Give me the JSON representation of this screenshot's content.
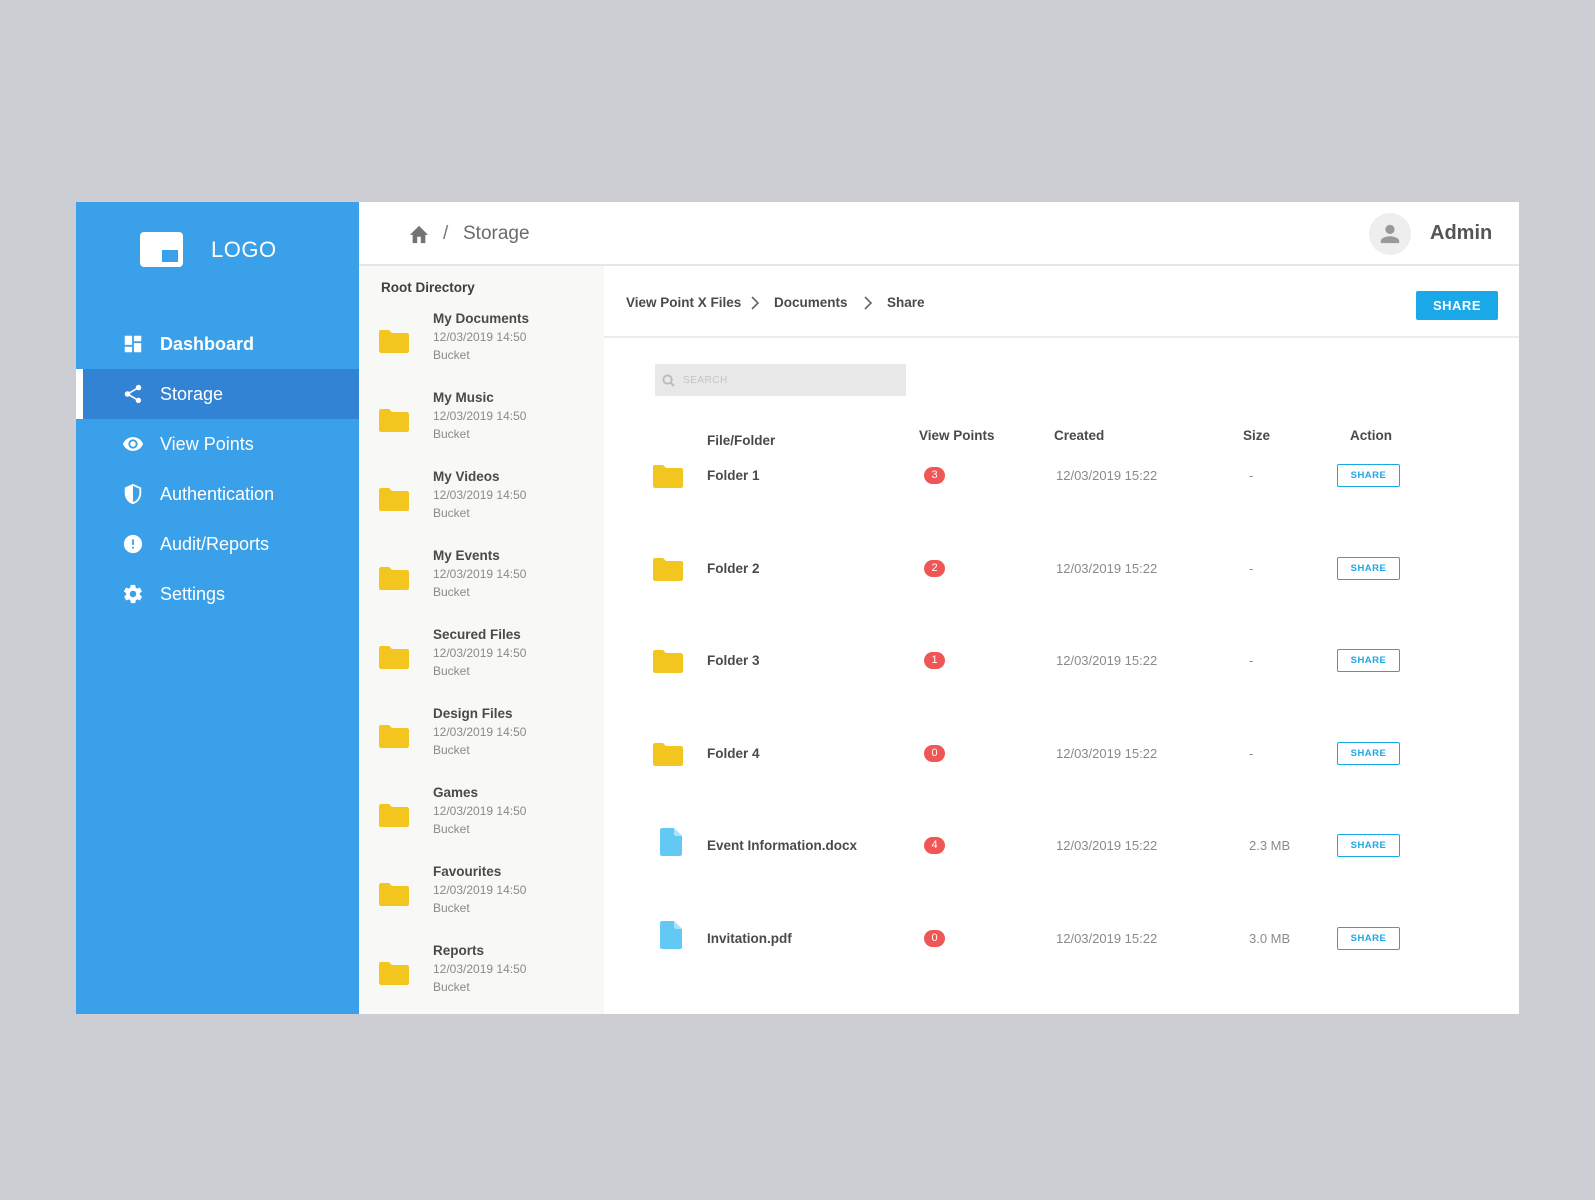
{
  "sidebar": {
    "logo_text": "LOGO",
    "items": [
      {
        "label": "Dashboard",
        "icon": "dashboard-icon"
      },
      {
        "label": "Storage",
        "icon": "share-icon"
      },
      {
        "label": "View Points",
        "icon": "eye-icon"
      },
      {
        "label": "Authentication",
        "icon": "shield-icon"
      },
      {
        "label": "Audit/Reports",
        "icon": "alert-icon"
      },
      {
        "label": "Settings",
        "icon": "gear-icon"
      }
    ],
    "active_item": "Storage"
  },
  "header": {
    "separator": "/",
    "title": "Storage",
    "user_name": "Admin"
  },
  "root_directory": {
    "title": "Root Directory",
    "items": [
      {
        "name": "My Documents",
        "date": "12/03/2019 14:50",
        "tag": "Bucket"
      },
      {
        "name": "My Music",
        "date": "12/03/2019 14:50",
        "tag": "Bucket"
      },
      {
        "name": "My Videos",
        "date": "12/03/2019 14:50",
        "tag": "Bucket"
      },
      {
        "name": "My Events",
        "date": "12/03/2019 14:50",
        "tag": "Bucket"
      },
      {
        "name": "Secured Files",
        "date": "12/03/2019 14:50",
        "tag": "Bucket"
      },
      {
        "name": "Design Files",
        "date": "12/03/2019 14:50",
        "tag": "Bucket"
      },
      {
        "name": "Games",
        "date": "12/03/2019 14:50",
        "tag": "Bucket"
      },
      {
        "name": "Favourites",
        "date": "12/03/2019 14:50",
        "tag": "Bucket"
      },
      {
        "name": "Reports",
        "date": "12/03/2019 14:50",
        "tag": "Bucket"
      }
    ]
  },
  "breadcrumb": {
    "items": [
      "View Point X Files",
      "Documents",
      "Share"
    ],
    "share_label": "SHARE"
  },
  "search": {
    "placeholder": "SEARCH"
  },
  "table": {
    "columns": [
      "File/Folder",
      "View Points",
      "Created",
      "Size",
      "Action"
    ],
    "rows": [
      {
        "name": "Folder 1",
        "type": "folder",
        "view_points": "3",
        "created": "12/03/2019 15:22",
        "size": "-",
        "action": "SHARE"
      },
      {
        "name": "Folder 2",
        "type": "folder",
        "view_points": "2",
        "created": "12/03/2019 15:22",
        "size": "-",
        "action": "SHARE"
      },
      {
        "name": "Folder 3",
        "type": "folder",
        "view_points": "1",
        "created": "12/03/2019 15:22",
        "size": "-",
        "action": "SHARE"
      },
      {
        "name": "Folder 4",
        "type": "folder",
        "view_points": "0",
        "created": "12/03/2019 15:22",
        "size": "-",
        "action": "SHARE"
      },
      {
        "name": "Event Information.docx",
        "type": "file",
        "view_points": "4",
        "created": "12/03/2019 15:22",
        "size": "2.3 MB",
        "action": "SHARE"
      },
      {
        "name": "Invitation.pdf",
        "type": "file",
        "view_points": "0",
        "created": "12/03/2019 15:22",
        "size": "3.0 MB",
        "action": "SHARE"
      }
    ]
  },
  "colors": {
    "sidebar": "#3aa0e9",
    "sidebar_active": "#3383d4",
    "accent": "#1ba8e8",
    "badge": "#f05656",
    "folder": "#f2c61f",
    "file": "#62c9f5"
  }
}
